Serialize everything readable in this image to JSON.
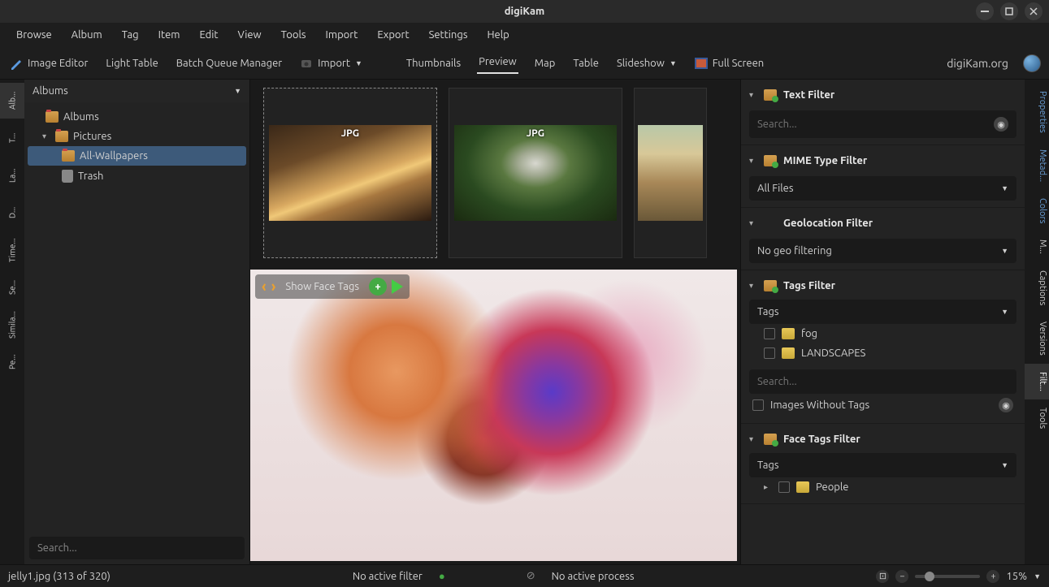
{
  "window": {
    "title": "digiKam"
  },
  "menu": [
    "Browse",
    "Album",
    "Tag",
    "Item",
    "Edit",
    "View",
    "Tools",
    "Import",
    "Export",
    "Settings",
    "Help"
  ],
  "toolbar": {
    "image_editor": "Image Editor",
    "light_table": "Light Table",
    "bqm": "Batch Queue Manager",
    "import": "Import",
    "thumbnails": "Thumbnails",
    "preview": "Preview",
    "map": "Map",
    "table": "Table",
    "slideshow": "Slideshow",
    "fullscreen": "Full Screen",
    "logo": "digiKam.org"
  },
  "left_rail": [
    "Alb...",
    "T...",
    "La...",
    "D...",
    "Time...",
    "Se...",
    "Simila...",
    "Pe..."
  ],
  "albums": {
    "header": "Albums",
    "root": "Albums",
    "pictures": "Pictures",
    "all_wallpapers": "All-Wallpapers",
    "trash": "Trash",
    "search_placeholder": "Search..."
  },
  "thumbs": [
    {
      "badge": "JPG"
    },
    {
      "badge": "JPG"
    },
    {
      "badge": ""
    }
  ],
  "preview": {
    "show_face_tags": "Show Face Tags"
  },
  "filters": {
    "text": {
      "title": "Text Filter",
      "placeholder": "Search..."
    },
    "mime": {
      "title": "MIME Type Filter",
      "value": "All Files"
    },
    "geo": {
      "title": "Geolocation Filter",
      "value": "No geo filtering"
    },
    "tags": {
      "title": "Tags Filter",
      "select": "Tags",
      "items": [
        "fog",
        "LANDSCAPES"
      ],
      "search_placeholder": "Search...",
      "images_without": "Images Without Tags"
    },
    "face": {
      "title": "Face Tags Filter",
      "select": "Tags",
      "people": "People"
    }
  },
  "right_rail": [
    "Properties",
    "Metad...",
    "Colors",
    "M...",
    "Captions",
    "Versions",
    "Filt...",
    "Tools"
  ],
  "status": {
    "file": "jelly1.jpg (313 of 320)",
    "filter": "No active filter",
    "process": "No active process",
    "zoom": "15%"
  }
}
